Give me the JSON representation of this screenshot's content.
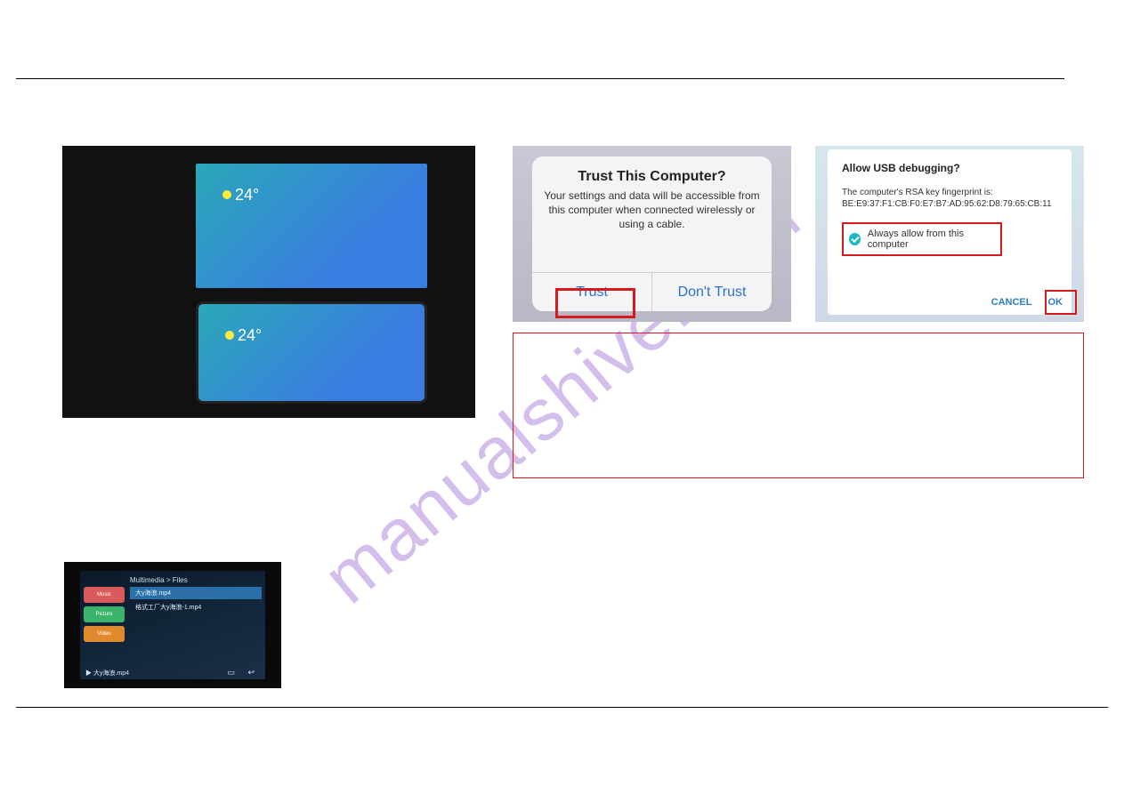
{
  "watermark": "manualshive.com",
  "car_screen": {
    "temperature_top": "24",
    "temperature_bottom": "24"
  },
  "trust_dialog": {
    "title": "Trust This Computer?",
    "body": "Your settings and data will be accessible from this computer when connected wirelessly or using a cable.",
    "trust_btn": "Trust",
    "dont_trust_btn": "Don't Trust"
  },
  "usb_dialog": {
    "title": "Allow USB debugging?",
    "line1": "The computer's RSA key fingerprint is:",
    "fingerprint": "BE:E9:37:F1:CB:F0:E7:B7:AD:95:62:D8:79:65:CB:11",
    "checkbox_label": "Always allow from this computer",
    "cancel": "CANCEL",
    "ok": "OK"
  },
  "multimedia": {
    "breadcrumb": "Multimedia > Files",
    "side": {
      "music": "Music",
      "picture": "Picture",
      "video": "Video"
    },
    "files": {
      "row1": "大y海浪.mp4",
      "row2": "格式工厂大y海浪-1.mp4"
    },
    "footer_playing": "▶ 大y海浪.mp4"
  }
}
